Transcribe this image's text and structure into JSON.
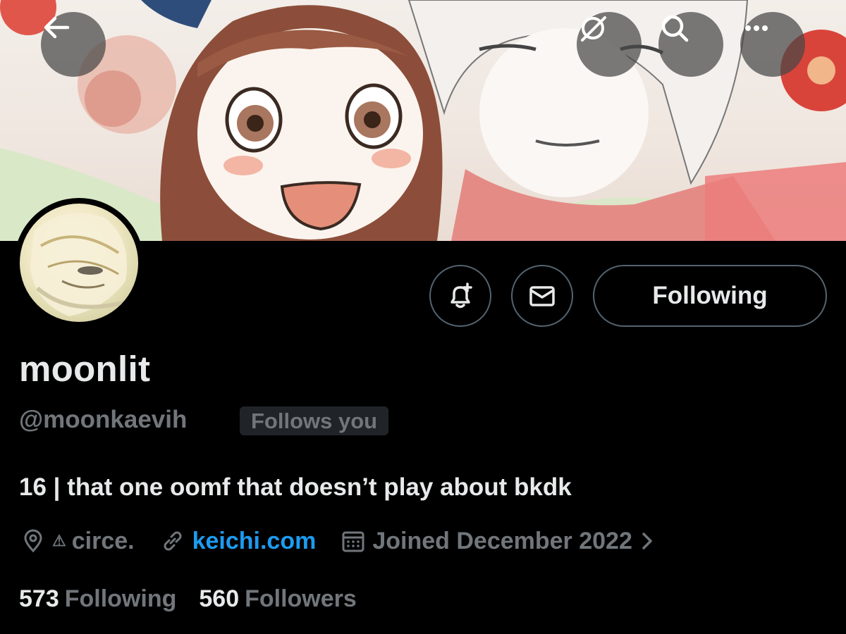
{
  "header": {
    "icons": [
      "back-arrow-icon",
      "translate-off-icon",
      "search-icon",
      "more-icon"
    ]
  },
  "profile": {
    "display_name": "moonlit",
    "handle": "@moonkaevih",
    "follows_you": "Follows you",
    "bio": "16 | that one oomf that doesn’t play about bkdk",
    "location_warning": "⚠",
    "location": "circe.",
    "website": "keichi.com",
    "joined": "Joined December 2022"
  },
  "actions": {
    "following_label": "Following"
  },
  "stats": {
    "following_count": "573",
    "following_label": "Following",
    "followers_count": "560",
    "followers_label": "Followers"
  },
  "colors": {
    "background": "#000000",
    "text_primary": "#e7e9ea",
    "text_secondary": "#71767b",
    "link": "#1d9bf0",
    "border": "#536471"
  }
}
